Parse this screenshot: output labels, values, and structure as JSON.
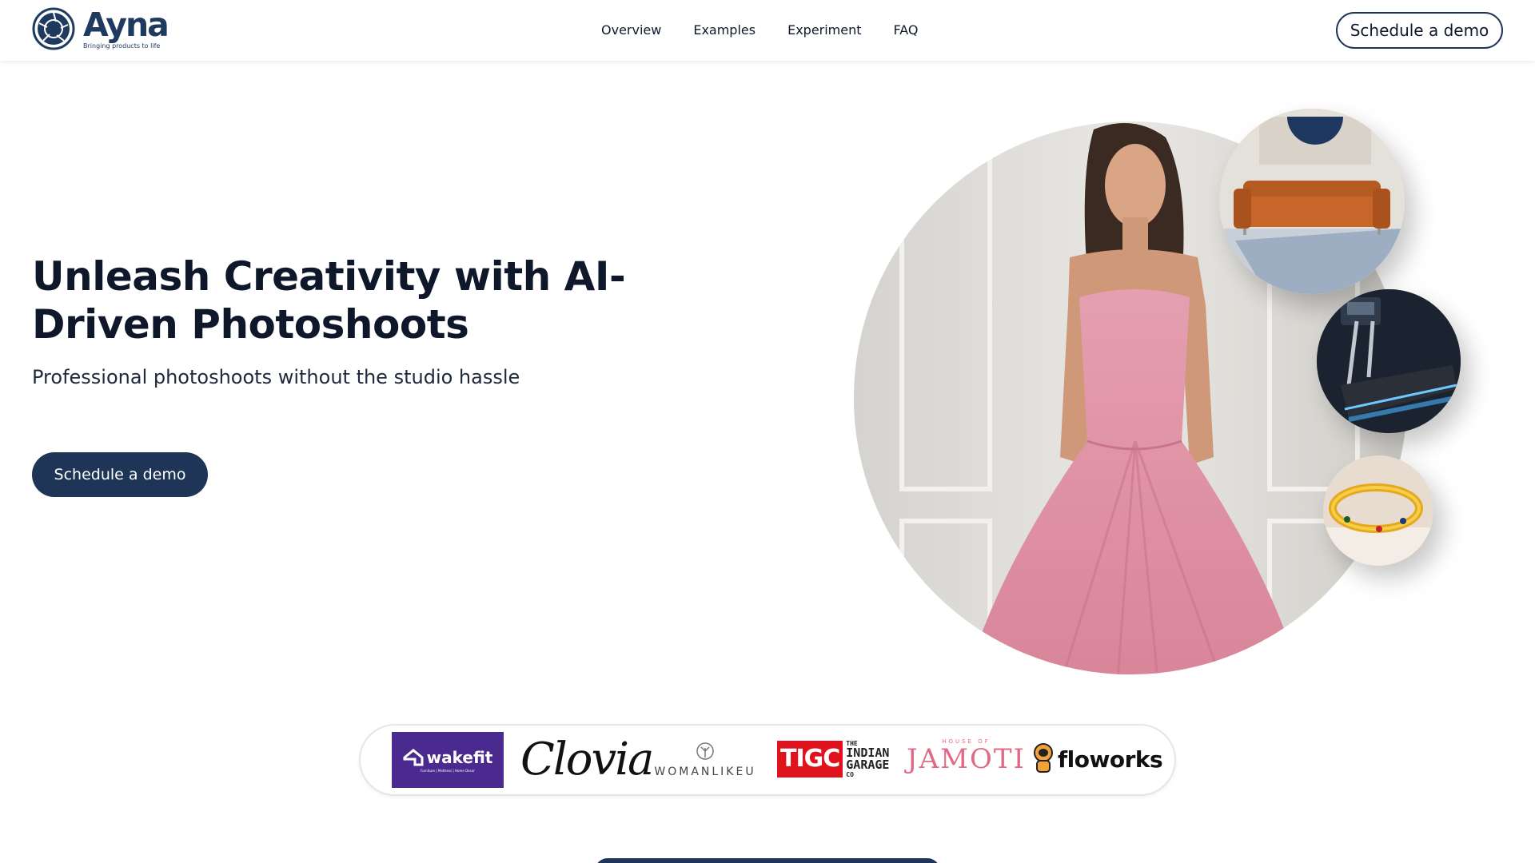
{
  "header": {
    "brand_name": "Ayna",
    "brand_tagline": "Bringing products to life",
    "nav": [
      "Overview",
      "Examples",
      "Experiment",
      "FAQ"
    ],
    "cta_label": "Schedule a demo"
  },
  "hero": {
    "title": "Unleash Creativity with AI-Driven Photoshoots",
    "subtitle": "Professional photoshoots without the studio hassle",
    "cta_label": "Schedule a demo"
  },
  "brands": {
    "wakefit": "wakefit",
    "wakefit_tag": "Furniture | Mattress | Home Decor",
    "clovia": "Clovia",
    "womanlikeu": "WOMANLIKEU",
    "tigc_short": "TIGC",
    "tigc_the": "THE",
    "tigc_indian": "INDIAN",
    "tigc_garage": "GARAGE",
    "tigc_co": "CO",
    "jamoti_top": "HOUSE OF",
    "jamoti": "JAMOTI",
    "floworks": "floworks"
  },
  "colors": {
    "primary": "#1e3558",
    "text": "#0f172a",
    "wakefit_bg": "#4b2a8f",
    "tigc_red": "#e0121b",
    "jamoti_pink": "#e06a86"
  },
  "icons": [
    "aperture-logo-icon",
    "house-logo-icon",
    "tree-logo-icon",
    "astronaut-logo-icon"
  ]
}
